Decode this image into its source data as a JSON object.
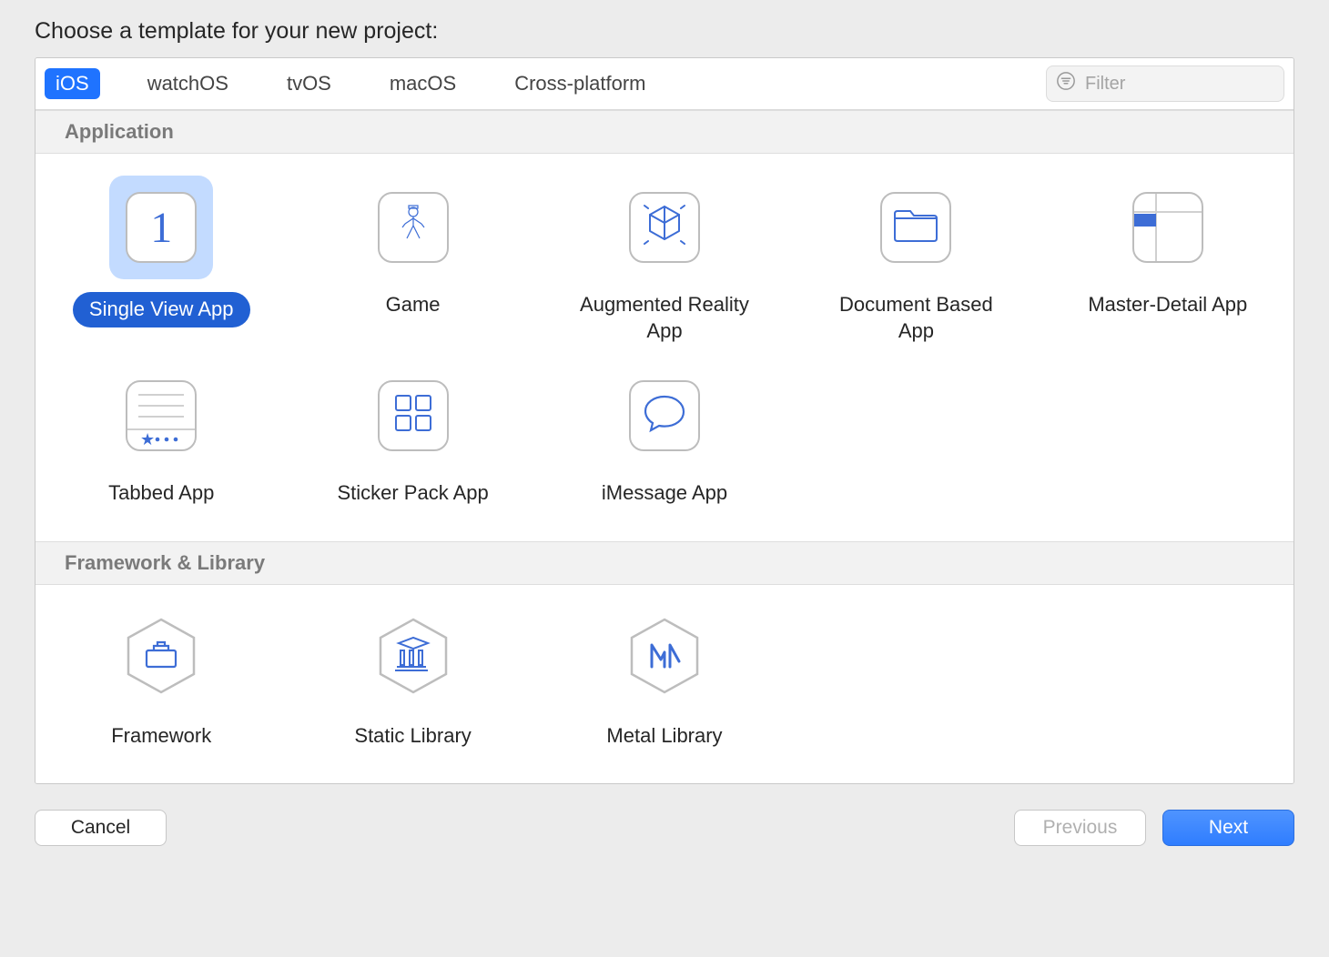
{
  "dialog": {
    "title": "Choose a template for your new project:"
  },
  "toolbar": {
    "tabs": [
      "iOS",
      "watchOS",
      "tvOS",
      "macOS",
      "Cross-platform"
    ],
    "selected_index": 0,
    "filter_placeholder": "Filter"
  },
  "sections": [
    {
      "title": "Application",
      "templates": [
        {
          "label": "Single View App",
          "icon": "single-view",
          "selected": true
        },
        {
          "label": "Game",
          "icon": "game",
          "selected": false
        },
        {
          "label": "Augmented Reality App",
          "icon": "ar",
          "selected": false
        },
        {
          "label": "Document Based App",
          "icon": "document",
          "selected": false
        },
        {
          "label": "Master-Detail App",
          "icon": "master-detail",
          "selected": false
        },
        {
          "label": "Tabbed App",
          "icon": "tabbed",
          "selected": false
        },
        {
          "label": "Sticker Pack App",
          "icon": "sticker",
          "selected": false
        },
        {
          "label": "iMessage App",
          "icon": "imessage",
          "selected": false
        }
      ]
    },
    {
      "title": "Framework & Library",
      "templates": [
        {
          "label": "Framework",
          "icon": "framework",
          "selected": false
        },
        {
          "label": "Static Library",
          "icon": "static-lib",
          "selected": false
        },
        {
          "label": "Metal Library",
          "icon": "metal-lib",
          "selected": false
        }
      ]
    }
  ],
  "footer": {
    "cancel": "Cancel",
    "previous": "Previous",
    "next": "Next"
  }
}
